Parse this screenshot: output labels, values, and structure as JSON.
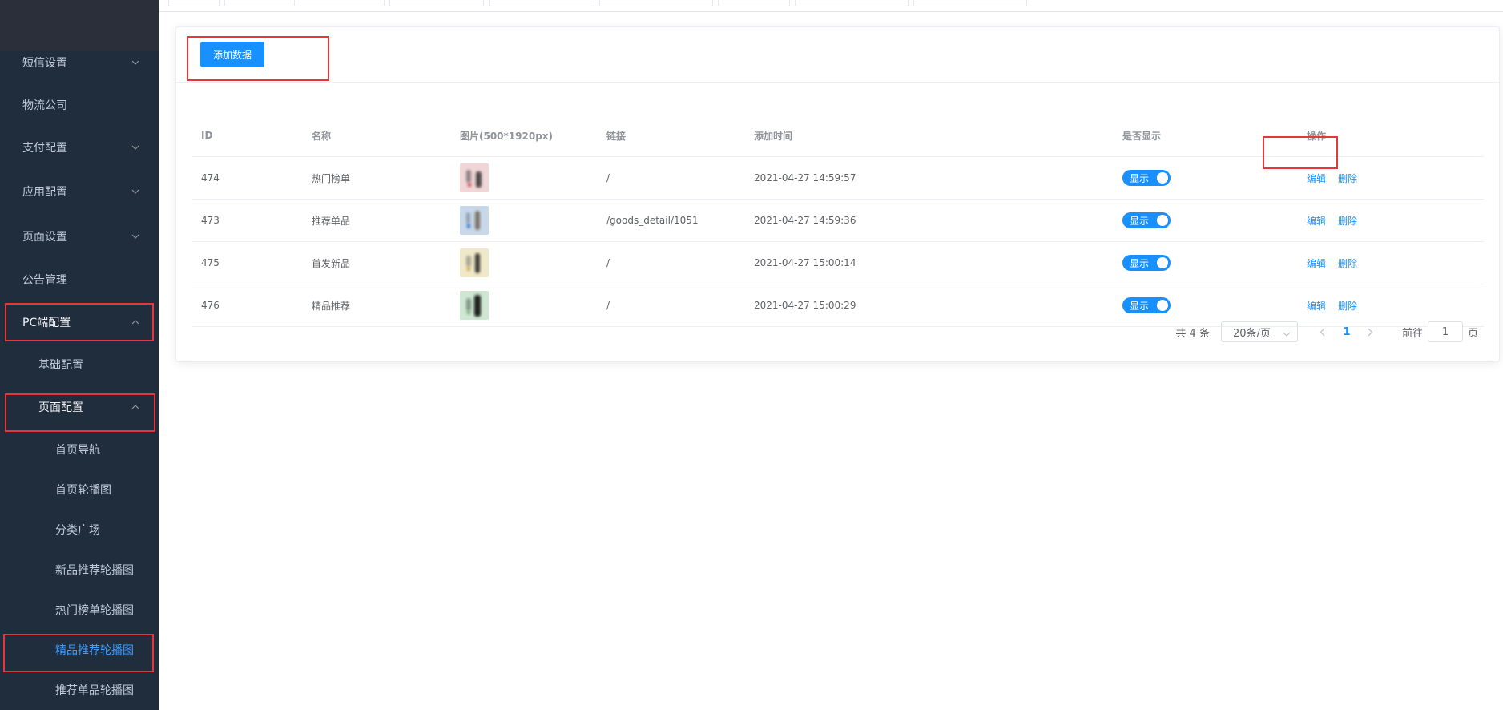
{
  "sidebar": {
    "items": [
      {
        "label": "短信设置",
        "has_arrow": true
      },
      {
        "label": "物流公司",
        "has_arrow": false
      },
      {
        "label": "支付配置",
        "has_arrow": true
      },
      {
        "label": "应用配置",
        "has_arrow": true
      },
      {
        "label": "页面设置",
        "has_arrow": true
      },
      {
        "label": "公告管理",
        "has_arrow": false
      },
      {
        "label": "PC端配置",
        "has_arrow": true,
        "open": true
      },
      {
        "label": "基础配置",
        "level": 2
      },
      {
        "label": "页面配置",
        "level": 2,
        "has_arrow": true,
        "open": true
      },
      {
        "label": "首页导航",
        "level": 3
      },
      {
        "label": "首页轮播图",
        "level": 3
      },
      {
        "label": "分类广场",
        "level": 3
      },
      {
        "label": "新品推荐轮播图",
        "level": 3
      },
      {
        "label": "热门榜单轮播图",
        "level": 3
      },
      {
        "label": "精品推荐轮播图",
        "level": 3,
        "active": true
      },
      {
        "label": "推荐单品轮播图",
        "level": 3
      }
    ]
  },
  "toolbar": {
    "add_label": "添加数据"
  },
  "table": {
    "headers": {
      "id": "ID",
      "name": "名称",
      "image": "图片(500*1920px)",
      "link": "链接",
      "time": "添加时间",
      "show": "是否显示",
      "ops": "操作"
    },
    "rows": [
      {
        "id": "474",
        "name": "热门榜单",
        "link": "/",
        "time": "2021-04-27 14:59:57",
        "show": "显示",
        "edit": "编辑",
        "delete": "删除"
      },
      {
        "id": "473",
        "name": "推荐单品",
        "link": "/goods_detail/1051",
        "time": "2021-04-27 14:59:36",
        "show": "显示",
        "edit": "编辑",
        "delete": "删除"
      },
      {
        "id": "475",
        "name": "首发新品",
        "link": "/",
        "time": "2021-04-27 15:00:14",
        "show": "显示",
        "edit": "编辑",
        "delete": "删除"
      },
      {
        "id": "476",
        "name": "精品推荐",
        "link": "/",
        "time": "2021-04-27 15:00:29",
        "show": "显示",
        "edit": "编辑",
        "delete": "删除"
      }
    ]
  },
  "pagination": {
    "total": "共 4 条",
    "page_size": "20条/页",
    "current_page": "1",
    "goto_label": "前往",
    "goto_value": "1",
    "page_suffix": "页"
  },
  "colors": {
    "primary": "#1890ff",
    "sidebar_bg": "#1f2d3d",
    "highlight_box": "#e8353a",
    "active_menu_text": "#409eff"
  },
  "icons": {
    "menu_arrow": "chevron-down-icon",
    "menu_arrow_open": "chevron-up-icon",
    "pager_prev": "chevron-left-icon",
    "pager_next": "chevron-right-icon"
  }
}
